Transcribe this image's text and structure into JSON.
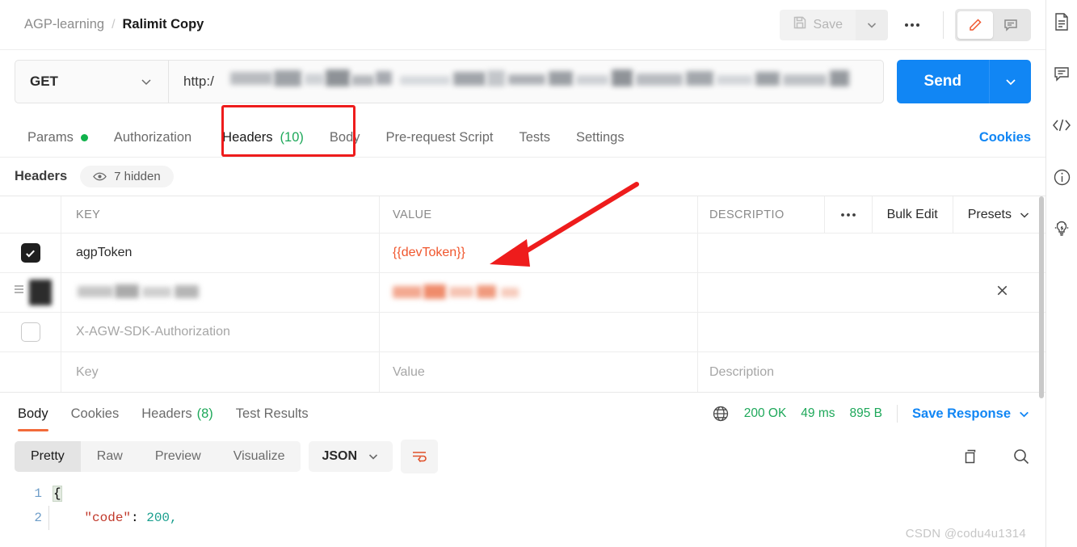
{
  "breadcrumb": {
    "collection": "AGP-learning",
    "separator": "/",
    "request": "Ralimit Copy"
  },
  "topbar": {
    "save_label": "Save",
    "save_icon": "floppy-disk-icon",
    "save_caret_icon": "chevron-down-icon",
    "more_icon": "three-dots-icon",
    "edit_icon": "pencil-icon",
    "comment_icon": "comment-icon"
  },
  "urlbar": {
    "method": "GET",
    "method_caret_icon": "chevron-down-icon",
    "url_visible": "http:/",
    "url_redacted": true,
    "send_label": "Send",
    "send_caret_icon": "chevron-down-icon",
    "accent_blue": "#1186f4"
  },
  "request_tabs": [
    {
      "label": "Params",
      "badge": "",
      "dot": true,
      "active": false
    },
    {
      "label": "Authorization",
      "badge": "",
      "dot": false,
      "active": false
    },
    {
      "label": "Headers",
      "badge": "(10)",
      "dot": false,
      "active": true
    },
    {
      "label": "Body",
      "badge": "",
      "dot": false,
      "active": false
    },
    {
      "label": "Pre-request Script",
      "badge": "",
      "dot": false,
      "active": false
    },
    {
      "label": "Tests",
      "badge": "",
      "dot": false,
      "active": false
    },
    {
      "label": "Settings",
      "badge": "",
      "dot": false,
      "active": false
    }
  ],
  "cookies_link": "Cookies",
  "headers_section": {
    "title": "Headers",
    "hidden_label": "7 hidden",
    "eye_icon": "eye-icon"
  },
  "headers_table": {
    "columns": [
      "KEY",
      "VALUE",
      "DESCRIPTIO"
    ],
    "actions": {
      "more_icon": "three-dots-icon",
      "bulk_edit": "Bulk Edit",
      "presets": "Presets",
      "presets_caret_icon": "chevron-down-icon"
    },
    "rows": [
      {
        "checked": true,
        "key": "agpToken",
        "value": "{{devToken}}",
        "description": "",
        "value_is_variable": true,
        "muted": false,
        "redacted": false
      },
      {
        "checked": true,
        "key": "",
        "value": "",
        "description": "",
        "value_is_variable": true,
        "muted": false,
        "redacted": true,
        "has_delete": true
      },
      {
        "checked": false,
        "key": "X-AGW-SDK-Authorization",
        "value": "",
        "description": "",
        "value_is_variable": false,
        "muted": true,
        "redacted": false
      }
    ],
    "placeholder_row": {
      "key": "Key",
      "value": "Value",
      "description": "Description"
    },
    "delete_icon": "close-x-icon"
  },
  "response": {
    "tabs": [
      {
        "label": "Body",
        "badge": "",
        "active": true
      },
      {
        "label": "Cookies",
        "badge": "",
        "active": false
      },
      {
        "label": "Headers",
        "badge": "(8)",
        "active": false
      },
      {
        "label": "Test Results",
        "badge": "",
        "active": false
      }
    ],
    "globe_icon": "globe-icon",
    "status": "200 OK",
    "time": "49 ms",
    "size": "895 B",
    "save_response": "Save Response",
    "save_response_caret_icon": "chevron-down-icon",
    "status_color": "#1ea85a"
  },
  "body_toolbar": {
    "formats": [
      {
        "label": "Pretty",
        "active": true
      },
      {
        "label": "Raw",
        "active": false
      },
      {
        "label": "Preview",
        "active": false
      },
      {
        "label": "Visualize",
        "active": false
      }
    ],
    "language": "JSON",
    "language_caret_icon": "chevron-down-icon",
    "wrap_icon": "word-wrap-icon",
    "copy_icon": "copy-icon",
    "search_icon": "search-icon"
  },
  "code": {
    "lines": [
      {
        "number": "1",
        "brace": "{",
        "key": "",
        "value": ""
      },
      {
        "number": "2",
        "brace": "",
        "key": "\"code\"",
        "value": "200,"
      }
    ]
  },
  "right_rail": [
    {
      "icon": "document-icon"
    },
    {
      "icon": "comment-icon"
    },
    {
      "icon": "code-icon"
    },
    {
      "icon": "info-icon"
    },
    {
      "icon": "lightbulb-icon"
    }
  ],
  "watermark": "CSDN @codu4u1314",
  "annotations": {
    "box_color": "#ee1c1c",
    "arrow_color": "#ee1c1c"
  }
}
